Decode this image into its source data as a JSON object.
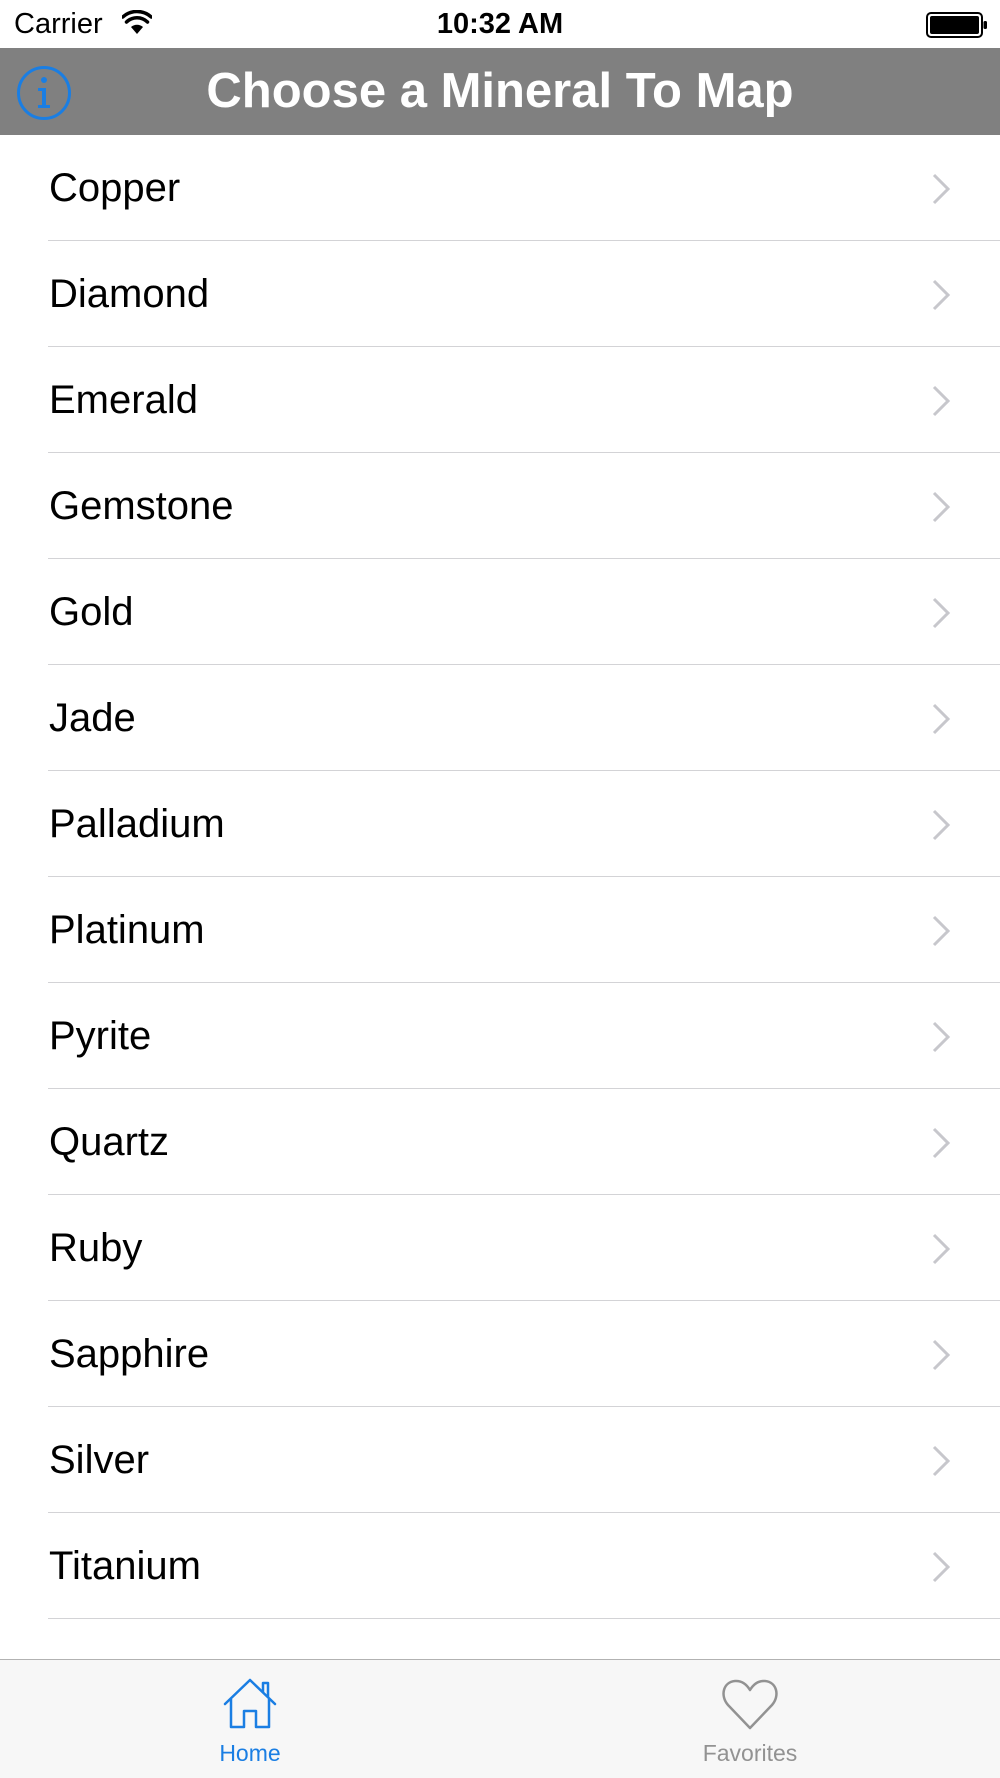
{
  "status_bar": {
    "carrier": "Carrier",
    "time": "10:32 AM",
    "wifi_icon": "wifi-icon",
    "battery_icon": "battery-icon"
  },
  "nav": {
    "title": "Choose a Mineral To Map",
    "info_icon": "info-icon",
    "background_color": "#808080",
    "accent_color": "#1a7ee3"
  },
  "minerals": [
    {
      "label": "Copper"
    },
    {
      "label": "Diamond"
    },
    {
      "label": "Emerald"
    },
    {
      "label": "Gemstone"
    },
    {
      "label": "Gold"
    },
    {
      "label": "Jade"
    },
    {
      "label": "Palladium"
    },
    {
      "label": "Platinum"
    },
    {
      "label": "Pyrite"
    },
    {
      "label": "Quartz"
    },
    {
      "label": "Ruby"
    },
    {
      "label": "Sapphire"
    },
    {
      "label": "Silver"
    },
    {
      "label": "Titanium"
    }
  ],
  "tab_bar": {
    "selected": "Home",
    "tabs": [
      {
        "label": "Home",
        "icon": "home-icon"
      },
      {
        "label": "Favorites",
        "icon": "heart-icon"
      }
    ]
  }
}
